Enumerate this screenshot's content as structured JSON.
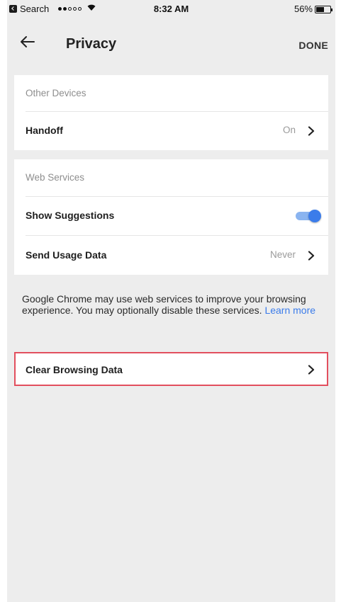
{
  "status_bar": {
    "carrier": "Search",
    "signal_dots_filled": 2,
    "signal_dots_total": 5,
    "wifi_icon": "wifi-icon",
    "time": "8:32 AM",
    "battery_percent_label": "56%",
    "battery_level": 0.56
  },
  "header": {
    "back_icon": "arrow-left-icon",
    "title": "Privacy",
    "done_label": "DONE"
  },
  "sections": {
    "other_devices": {
      "header": "Other Devices",
      "handoff": {
        "label": "Handoff",
        "value": "On"
      }
    },
    "web_services": {
      "header": "Web Services",
      "show_suggestions": {
        "label": "Show Suggestions",
        "enabled": true
      },
      "send_usage_data": {
        "label": "Send Usage Data",
        "value": "Never"
      }
    }
  },
  "description": {
    "text": "Google Chrome may use web services to improve your browsing experience. You may optionally disable these services.",
    "link": "Learn more"
  },
  "clear_browsing_data": {
    "label": "Clear Browsing Data"
  },
  "colors": {
    "accent": "#3b7cea",
    "toggle_track": "#8ab4f0",
    "highlight_border": "#e24f5e",
    "background": "#ededed"
  }
}
